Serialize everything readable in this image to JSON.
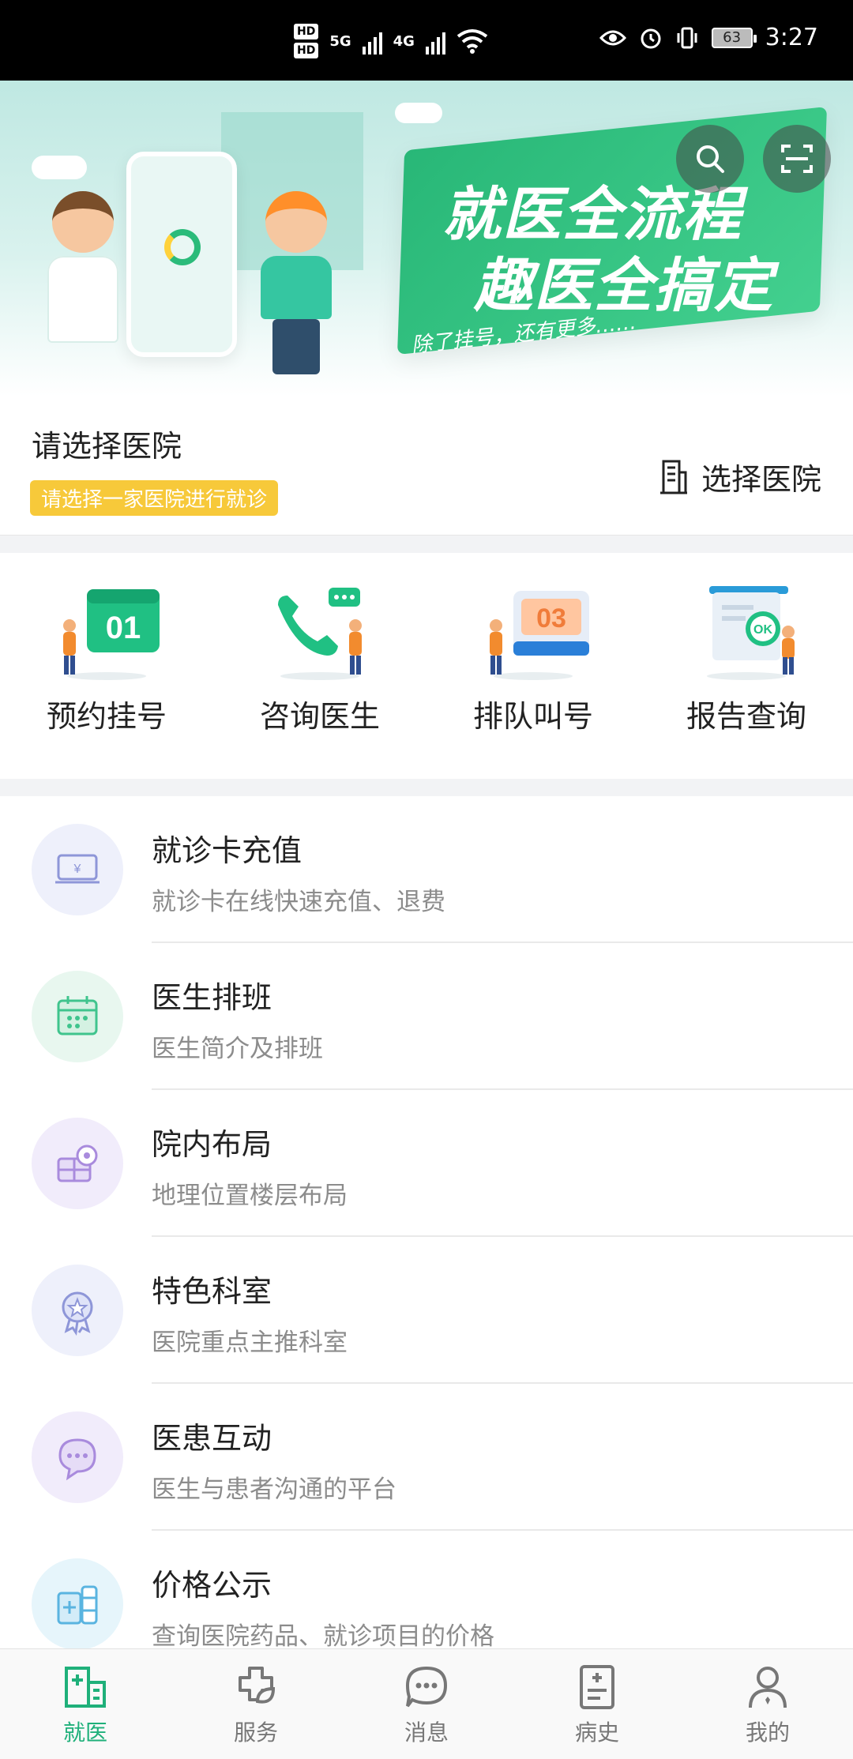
{
  "status": {
    "time": "3:27",
    "battery": "63",
    "hd1": "HD",
    "hd2": "HD",
    "net1": "5G",
    "net2": "4G"
  },
  "banner": {
    "line1": "就医全流程",
    "line2": "趣医全搞定",
    "line3": "除了挂号，还有更多……"
  },
  "hospital": {
    "title": "请选择医院",
    "badge": "请选择一家医院进行就诊",
    "select_label": "选择医院"
  },
  "quick": [
    {
      "label": "预约挂号",
      "number": "01"
    },
    {
      "label": "咨询医生"
    },
    {
      "label": "排队叫号",
      "number": "03"
    },
    {
      "label": "报告查询",
      "mark": "OK"
    }
  ],
  "list": [
    {
      "title": "就诊卡充值",
      "subtitle": "就诊卡在线快速充值、退费",
      "icon": "card-recharge-icon",
      "color": "#eef0fb"
    },
    {
      "title": "医生排班",
      "subtitle": "医生简介及排班",
      "icon": "calendar-icon",
      "color": "#e8f7ef"
    },
    {
      "title": "院内布局",
      "subtitle": "地理位置楼层布局",
      "icon": "map-pin-icon",
      "color": "#f1ecfb"
    },
    {
      "title": "特色科室",
      "subtitle": "医院重点主推科室",
      "icon": "badge-star-icon",
      "color": "#eef0fb"
    },
    {
      "title": "医患互动",
      "subtitle": "医生与患者沟通的平台",
      "icon": "chat-bubble-icon",
      "color": "#f1ecfb"
    },
    {
      "title": "价格公示",
      "subtitle": "查询医院药品、就诊项目的价格",
      "icon": "medicine-icon",
      "color": "#e6f5fb"
    }
  ],
  "nav": [
    {
      "label": "就医",
      "icon": "hospital-icon",
      "active": true
    },
    {
      "label": "服务",
      "icon": "service-icon",
      "active": false
    },
    {
      "label": "消息",
      "icon": "message-icon",
      "active": false
    },
    {
      "label": "病史",
      "icon": "medical-record-icon",
      "active": false
    },
    {
      "label": "我的",
      "icon": "user-icon",
      "active": false
    }
  ]
}
